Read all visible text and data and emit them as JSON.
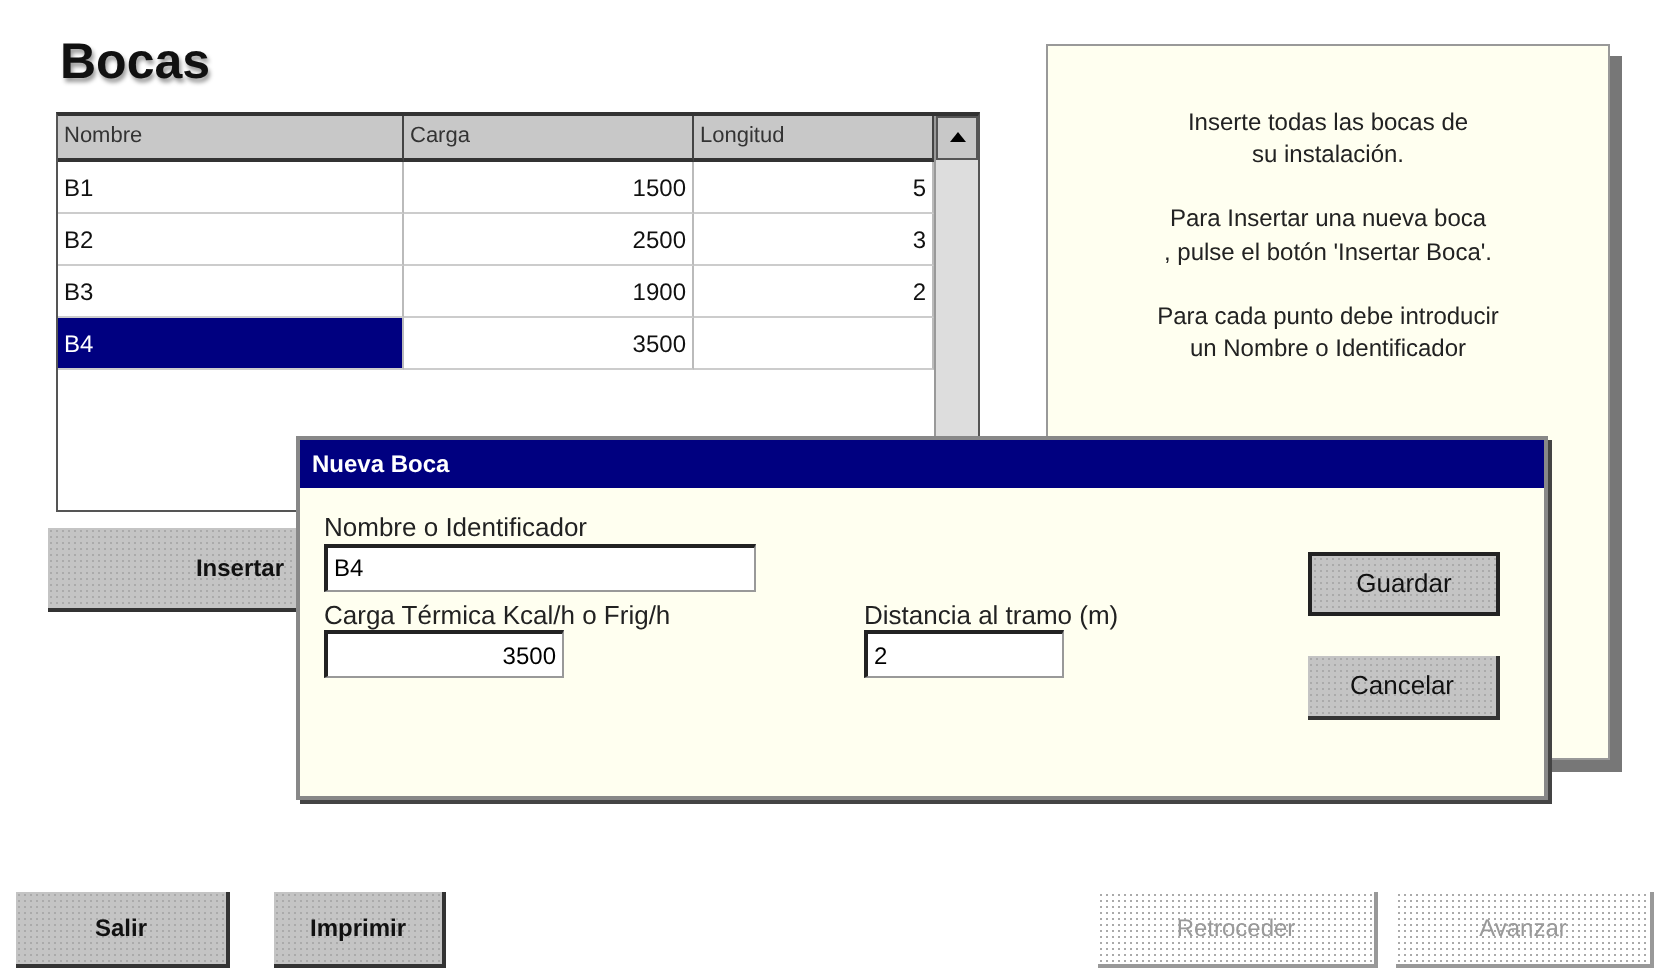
{
  "title": "Bocas",
  "table": {
    "columns": [
      "Nombre",
      "Carga",
      "Longitud"
    ],
    "rows": [
      {
        "nombre": "B1",
        "carga": "1500",
        "longitud": "5",
        "selected": false
      },
      {
        "nombre": "B2",
        "carga": "2500",
        "longitud": "3",
        "selected": false
      },
      {
        "nombre": "B3",
        "carga": "1900",
        "longitud": "2",
        "selected": false
      },
      {
        "nombre": "B4",
        "carga": "3500",
        "selected": true
      }
    ]
  },
  "insert_button": "Insertar",
  "info_panel": {
    "paragraphs": [
      [
        "Inserte todas las bocas de",
        "su instalación."
      ],
      [
        "Para Insertar una nueva boca",
        ", pulse el botón 'Insertar Boca'."
      ],
      [
        "Para cada punto debe introducir",
        "un Nombre o Identificador"
      ]
    ]
  },
  "dialog": {
    "title": "Nueva Boca",
    "fields": [
      {
        "label": "Nombre o Identificador",
        "value": "B4",
        "kind": "text"
      },
      {
        "label": "Carga Térmica Kcal/h o Frig/h",
        "value": "3500",
        "kind": "number"
      },
      {
        "label": "Distancia al tramo (m)",
        "value": "2",
        "kind": "text"
      }
    ],
    "buttons": [
      {
        "label": "Guardar",
        "default": true
      },
      {
        "label": "Cancelar",
        "default": false
      }
    ]
  },
  "nav_buttons": [
    {
      "label": "Salir",
      "disabled": false
    },
    {
      "label": "Imprimir",
      "disabled": false
    },
    {
      "label": "Retroceder",
      "disabled": true
    },
    {
      "label": "Avanzar",
      "disabled": true
    }
  ]
}
